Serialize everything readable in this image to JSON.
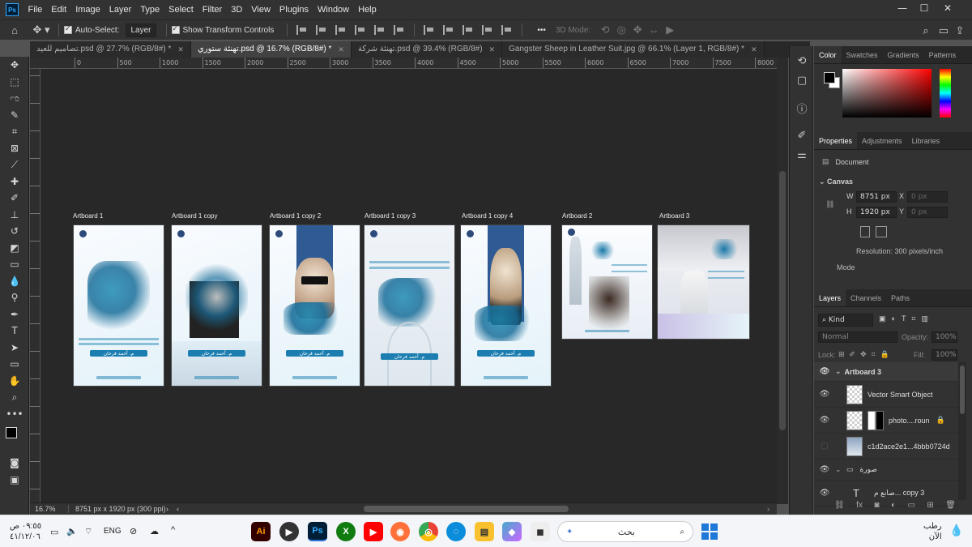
{
  "menubar": {
    "logo": "Ps",
    "items": [
      "File",
      "Edit",
      "Image",
      "Layer",
      "Type",
      "Select",
      "Filter",
      "3D",
      "View",
      "Plugins",
      "Window",
      "Help"
    ],
    "window_controls": [
      "—",
      "☐",
      "✕"
    ]
  },
  "options": {
    "auto_select_label": "Auto-Select:",
    "auto_select_value": "Layer",
    "transform_label": "Show Transform Controls",
    "mode_3d": "3D Mode:",
    "more": "•••"
  },
  "tabs": [
    {
      "label": "تصاميم للعيد.psd @ 27.7% (RGB/8#) *",
      "active": false
    },
    {
      "label": "تهنئة ستوري.psd @ 16.7% (RGB/8#) *",
      "active": true
    },
    {
      "label": "تهنئة شركة.psd @ 39.4% (RGB/8#)",
      "active": false
    },
    {
      "label": "Gangster Sheep in Leather Suit.jpg @ 66.1% (Layer 1, RGB/8#) *",
      "active": false
    }
  ],
  "ruler_ticks": [
    "0",
    "500",
    "1000",
    "1500",
    "2000",
    "2500",
    "3000",
    "3500",
    "4000",
    "4500",
    "5000",
    "5500",
    "6000",
    "6500",
    "7000",
    "7500",
    "8000"
  ],
  "artboards": [
    {
      "label": "Artboard 1",
      "name": "م. أحمد فرحان"
    },
    {
      "label": "Artboard 1 copy",
      "name": "م. أحمد فرحان"
    },
    {
      "label": "Artboard 1 copy 2",
      "name": "م. أحمد فرحان"
    },
    {
      "label": "Artboard 1 copy 3",
      "name": "م. أحمد فرحان"
    },
    {
      "label": "Artboard 1 copy 4",
      "name": "م. أحمد فرحان"
    },
    {
      "label": "Artboard 2",
      "name": ""
    },
    {
      "label": "Artboard 3",
      "name": ""
    }
  ],
  "status": {
    "zoom": "16.7%",
    "info": "8751 px x 1920 px (300 ppi)"
  },
  "color_panel": {
    "tabs": [
      "Color",
      "Swatches",
      "Gradients",
      "Patterns"
    ],
    "picker_hue": "#ff0000"
  },
  "properties": {
    "tabs": [
      "Properties",
      "Adjustments",
      "Libraries"
    ],
    "doc_label": "Document",
    "canvas_label": "Canvas",
    "w_label": "W",
    "w_value": "8751 px",
    "h_label": "H",
    "h_value": "1920 px",
    "x_label": "X",
    "x_placeholder": "0 px",
    "y_label": "Y",
    "y_placeholder": "0 px",
    "resolution": "Resolution: 300 pixels/inch",
    "mode": "Mode"
  },
  "layers_panel": {
    "tabs": [
      "Layers",
      "Channels",
      "Paths"
    ],
    "kind": "Kind",
    "blend": "Normal",
    "opacity_label": "Opacity:",
    "opacity_value": "100%",
    "lock_label": "Lock:",
    "fill_label": "Fill:",
    "fill_value": "100%",
    "layers": [
      {
        "name": "Artboard 3",
        "type": "artboard"
      },
      {
        "name": "Vector Smart Object",
        "type": "smart"
      },
      {
        "name": "photo....roun",
        "type": "mask"
      },
      {
        "name": "c1d2ace2e1...4bbb0724d",
        "type": "image"
      },
      {
        "name": "صورة",
        "type": "group"
      },
      {
        "name": "صانع م... copy 3",
        "type": "text"
      }
    ]
  },
  "taskbar": {
    "time": "٠٩:٥٥ ص",
    "date": "٤١/١٢/٠٦",
    "lang": "ENG",
    "search_placeholder": "بحث",
    "weather": "رطب",
    "weather_sub": "الآن",
    "apps": [
      "Ai",
      "▶",
      "Ps",
      "X",
      "▶",
      "◉",
      "◎",
      "◌",
      "▤",
      "◆",
      "◼"
    ]
  }
}
